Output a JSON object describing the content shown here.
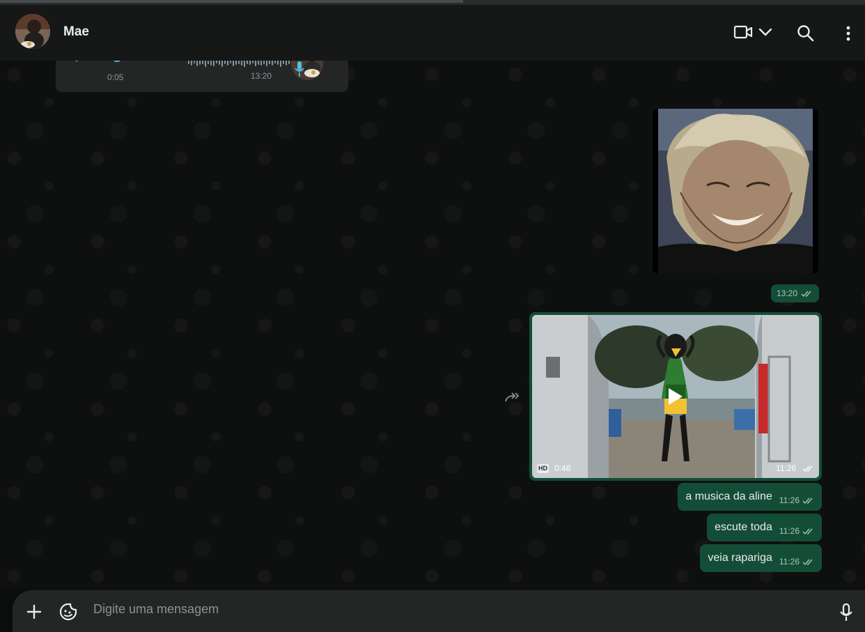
{
  "header": {
    "contact_name": "Mae",
    "icons": [
      "avatar",
      "video-call-icon",
      "chevron-down-icon",
      "search-icon",
      "menu-dots-icon"
    ]
  },
  "messages": {
    "voice_note": {
      "duration": "0:05",
      "time": "13:20"
    },
    "image_message": {
      "time": "13:20"
    },
    "video_message": {
      "badge": "HD",
      "duration": "0:46",
      "time": "11:26"
    },
    "text_messages": [
      {
        "text": "a musica da aline",
        "time": "11:26"
      },
      {
        "text": "escute toda",
        "time": "11:26"
      },
      {
        "text": "veia rapariga",
        "time": "11:26"
      }
    ]
  },
  "compose": {
    "placeholder": "Digite uma mensagem"
  },
  "colors": {
    "header_bg": "#161717",
    "outgoing_bubble": "#144d37",
    "incoming_bubble": "#242626",
    "accent": "#53bdeb"
  }
}
